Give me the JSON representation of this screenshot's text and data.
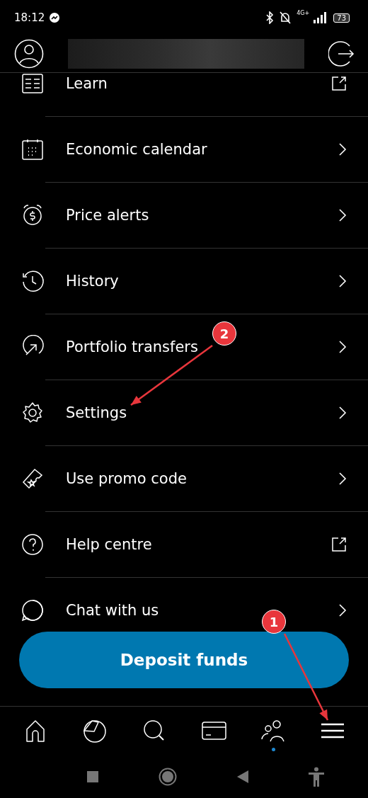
{
  "status_bar": {
    "time": "18:12",
    "network": "4G+",
    "battery": "73"
  },
  "menu_items": [
    {
      "label": "Learn",
      "kind": "external"
    },
    {
      "label": "Economic calendar",
      "kind": "chevron"
    },
    {
      "label": "Price alerts",
      "kind": "chevron"
    },
    {
      "label": "History",
      "kind": "chevron"
    },
    {
      "label": "Portfolio transfers",
      "kind": "chevron"
    },
    {
      "label": "Settings",
      "kind": "chevron"
    },
    {
      "label": "Use promo code",
      "kind": "chevron"
    },
    {
      "label": "Help centre",
      "kind": "external"
    },
    {
      "label": "Chat with us",
      "kind": "chevron"
    }
  ],
  "deposit_button": "Deposit funds",
  "bottom_nav": [
    {
      "selected": false
    },
    {
      "selected": false
    },
    {
      "selected": false
    },
    {
      "selected": false
    },
    {
      "selected": true
    },
    {
      "selected": false
    }
  ],
  "annotations": [
    {
      "label": "2"
    },
    {
      "label": "1"
    }
  ]
}
